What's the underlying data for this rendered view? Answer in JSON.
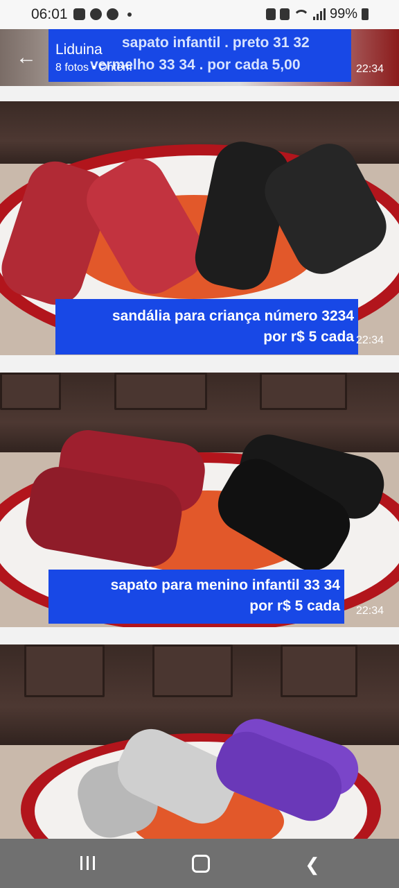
{
  "status_bar": {
    "time": "06:01",
    "battery": "99%"
  },
  "header": {
    "chat_name": "Liduina",
    "meta": "8 fotos • Ontem",
    "banner_line1": "sapato infantil . preto 31 32",
    "banner_line2": "vermelho 33 34 . por cada 5,00",
    "time": "22:34"
  },
  "photos": [
    {
      "caption_line1": "sandália para criança número 3234",
      "caption_line2": "por r$ 5 cada",
      "time": "22:34"
    },
    {
      "caption_line1": "sapato para menino infantil 33 34",
      "caption_line2": "por r$ 5 cada",
      "time": "22:34"
    },
    {
      "caption_line1": "",
      "caption_line2": "",
      "time": ""
    }
  ],
  "colors": {
    "accent": "#1848e6",
    "nav_bar": "#707070"
  },
  "icons": {
    "back": "arrow-left-icon",
    "nav_recents": "recents-icon",
    "nav_home": "home-icon",
    "nav_back": "chevron-left-icon"
  }
}
